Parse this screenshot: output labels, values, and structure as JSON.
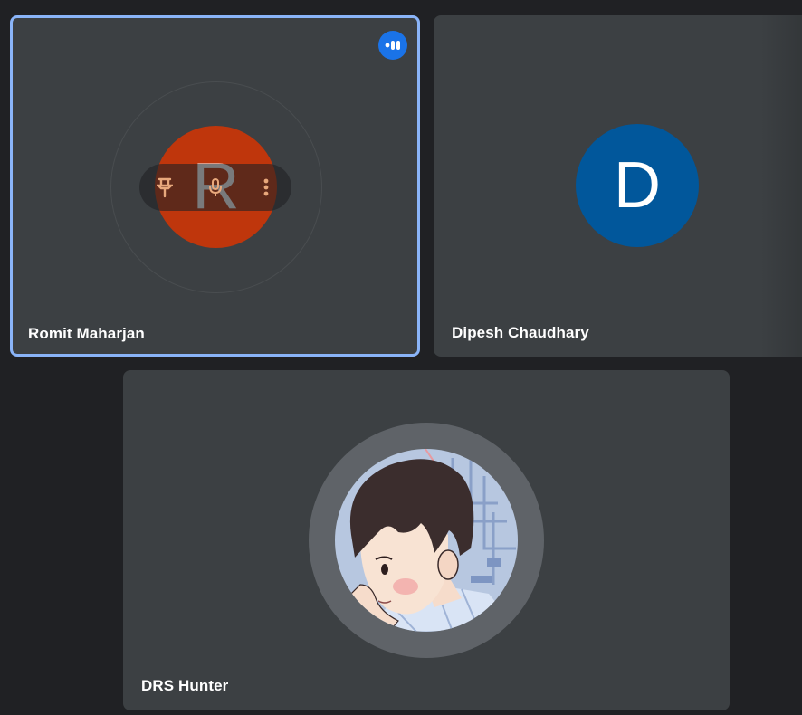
{
  "participants": [
    {
      "name": "Romit Maharjan",
      "initial": "R",
      "avatar_color": "#bf360c",
      "active_speaker": true,
      "controls": {
        "pin_icon": "pin-icon",
        "mic_icon": "mic-off-icon",
        "more_icon": "more-vert-icon"
      },
      "speaking_indicator_icon": "audio-level-icon"
    },
    {
      "name": "Dipesh Chaudhary",
      "initial": "D",
      "avatar_color": "#01579b",
      "active_speaker": false
    },
    {
      "name": "DRS Hunter",
      "avatar_type": "photo",
      "active_speaker": false
    }
  ],
  "colors": {
    "background": "#202124",
    "tile": "#3c4043",
    "active_border": "#8ab4f8",
    "speaking_badge": "#1a73e8"
  }
}
